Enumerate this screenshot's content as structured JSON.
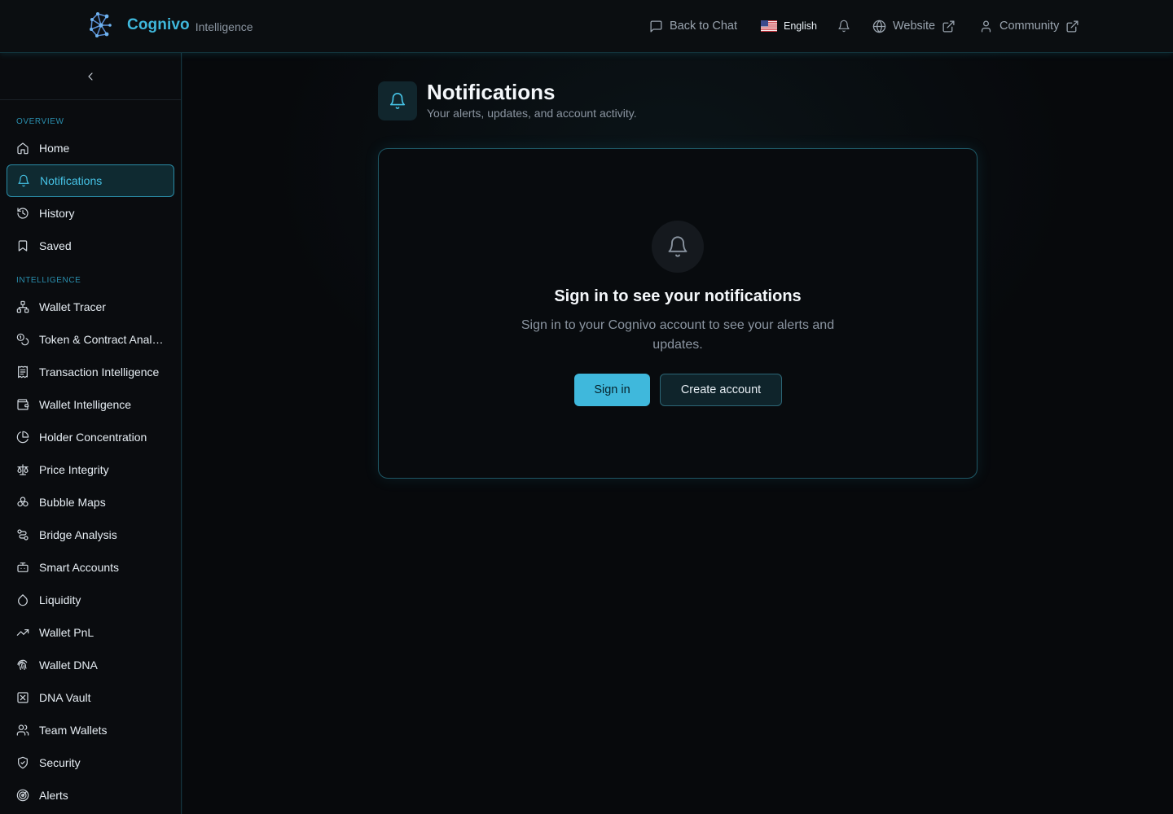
{
  "app": {
    "brand": "Cognivo",
    "brand_sub": "Intelligence",
    "accent": "#3fb8dc"
  },
  "header": {
    "back_to_chat": "Back to Chat",
    "language": "English",
    "website": "Website",
    "community": "Community"
  },
  "sidebar": {
    "overview_title": "OVERVIEW",
    "intelligence_title": "INTELLIGENCE",
    "overview_items": [
      {
        "label": "Home",
        "icon": "home-icon"
      },
      {
        "label": "Notifications",
        "icon": "bell-icon",
        "active": true
      },
      {
        "label": "History",
        "icon": "history-icon"
      },
      {
        "label": "Saved",
        "icon": "bookmark-icon"
      }
    ],
    "intelligence_items": [
      {
        "label": "Wallet Tracer",
        "icon": "network-icon"
      },
      {
        "label": "Token & Contract Analysis",
        "icon": "coins-icon"
      },
      {
        "label": "Transaction Intelligence",
        "icon": "receipt-icon"
      },
      {
        "label": "Wallet Intelligence",
        "icon": "wallet-icon"
      },
      {
        "label": "Holder Concentration",
        "icon": "pie-chart-icon"
      },
      {
        "label": "Price Integrity",
        "icon": "scale-icon"
      },
      {
        "label": "Bubble Maps",
        "icon": "bubbles-icon"
      },
      {
        "label": "Bridge Analysis",
        "icon": "bridge-icon"
      },
      {
        "label": "Smart Accounts",
        "icon": "bot-icon"
      },
      {
        "label": "Liquidity",
        "icon": "droplet-icon"
      },
      {
        "label": "Wallet PnL",
        "icon": "trending-up-icon"
      },
      {
        "label": "Wallet DNA",
        "icon": "fingerprint-icon"
      },
      {
        "label": "DNA Vault",
        "icon": "vault-icon"
      },
      {
        "label": "Team Wallets",
        "icon": "users-icon"
      },
      {
        "label": "Security",
        "icon": "shield-icon"
      },
      {
        "label": "Alerts",
        "icon": "radar-icon"
      }
    ]
  },
  "page": {
    "title": "Notifications",
    "subtitle": "Your alerts, updates, and account activity."
  },
  "empty_state": {
    "title": "Sign in to see your notifications",
    "description": "Sign in to your Cognivo account to see your alerts and updates.",
    "signin_label": "Sign in",
    "create_label": "Create account"
  }
}
